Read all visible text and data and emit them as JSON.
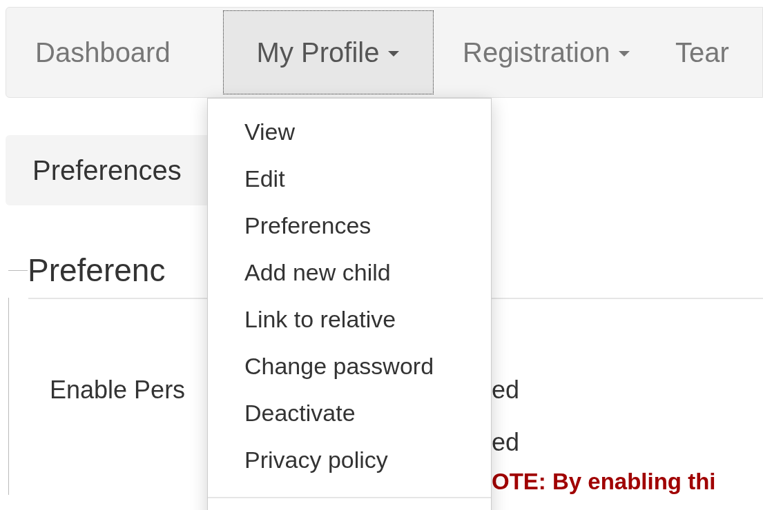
{
  "navbar": {
    "items": [
      {
        "label": "Dashboard",
        "has_menu": false,
        "expanded": false
      },
      {
        "label": "My Profile",
        "has_menu": true,
        "expanded": true
      },
      {
        "label": "Registration",
        "has_menu": true,
        "expanded": false
      },
      {
        "label": "Tear",
        "has_menu": false,
        "expanded": false
      }
    ]
  },
  "breadcrumb": {
    "label": "Preferences"
  },
  "legend": "Preferenc",
  "rows": [
    {
      "label": "Enable Pers",
      "value": "ed"
    },
    {
      "value": "ed"
    }
  ],
  "notice": "OTE: By enabling thi",
  "dropdown": {
    "items": [
      "View",
      "Edit",
      "Preferences",
      "Add new child",
      "Link to relative",
      "Change password",
      "Deactivate",
      "Privacy policy"
    ]
  }
}
